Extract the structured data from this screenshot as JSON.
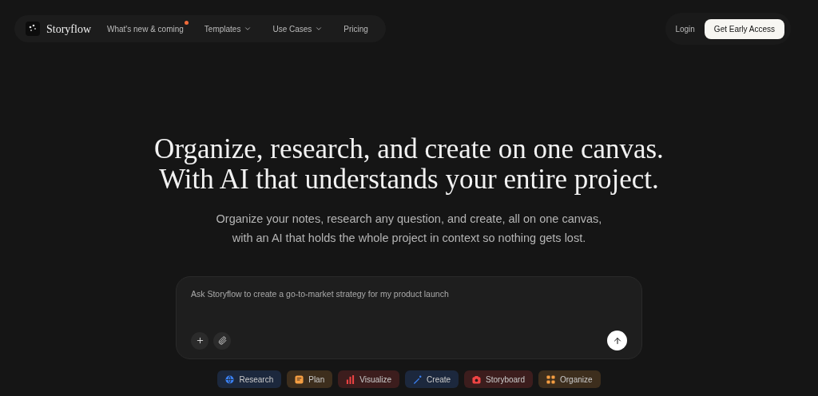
{
  "nav": {
    "brand": "Storyflow",
    "links": [
      {
        "label": "What's new & coming",
        "dot": true,
        "dropdown": false
      },
      {
        "label": "Templates",
        "dot": false,
        "dropdown": true
      },
      {
        "label": "Use Cases",
        "dot": false,
        "dropdown": true
      },
      {
        "label": "Pricing",
        "dot": false,
        "dropdown": false
      }
    ],
    "login": "Login",
    "cta": "Get Early Access"
  },
  "hero": {
    "headline": [
      "Organize, research, and create on one canvas.",
      "With AI that understands your entire project."
    ],
    "subtitle": [
      "Organize your notes, research any question, and create, all on one canvas,",
      "with an AI that holds the whole project in context so nothing gets lost."
    ]
  },
  "prompt": {
    "value": "Ask Storyflow to create a go-to-market strategy for my product launch"
  },
  "chips": [
    {
      "label": "Research",
      "kind": "globe",
      "color": "#3b82f6"
    },
    {
      "label": "Plan",
      "kind": "plan",
      "color": "#f59e42"
    },
    {
      "label": "Visualize",
      "kind": "chart",
      "color": "#ef4444"
    },
    {
      "label": "Create",
      "kind": "wand",
      "color": "#3b82f6"
    },
    {
      "label": "Storyboard",
      "kind": "camera",
      "color": "#ef4444"
    },
    {
      "label": "Organize",
      "kind": "grid",
      "color": "#f59e42"
    }
  ]
}
